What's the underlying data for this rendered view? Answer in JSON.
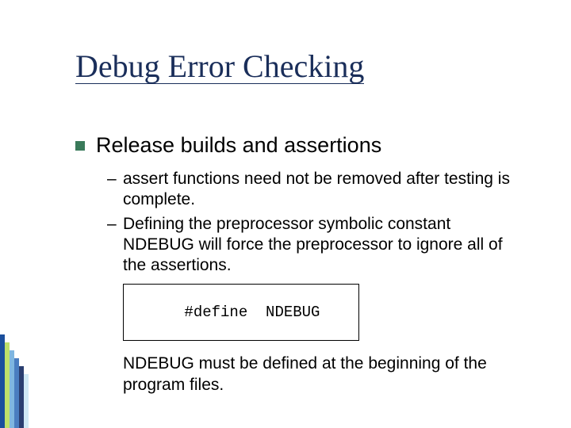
{
  "title": "Debug Error Checking",
  "bullets": {
    "main": "Release builds and assertions",
    "sub1": "assert functions need not be removed after testing is complete.",
    "sub2": "Defining the preprocessor symbolic constant NDEBUG will force the preprocessor to ignore all of the assertions."
  },
  "code": "#define  NDEBUG",
  "note": "NDEBUG must be defined at the beginning of the program files."
}
